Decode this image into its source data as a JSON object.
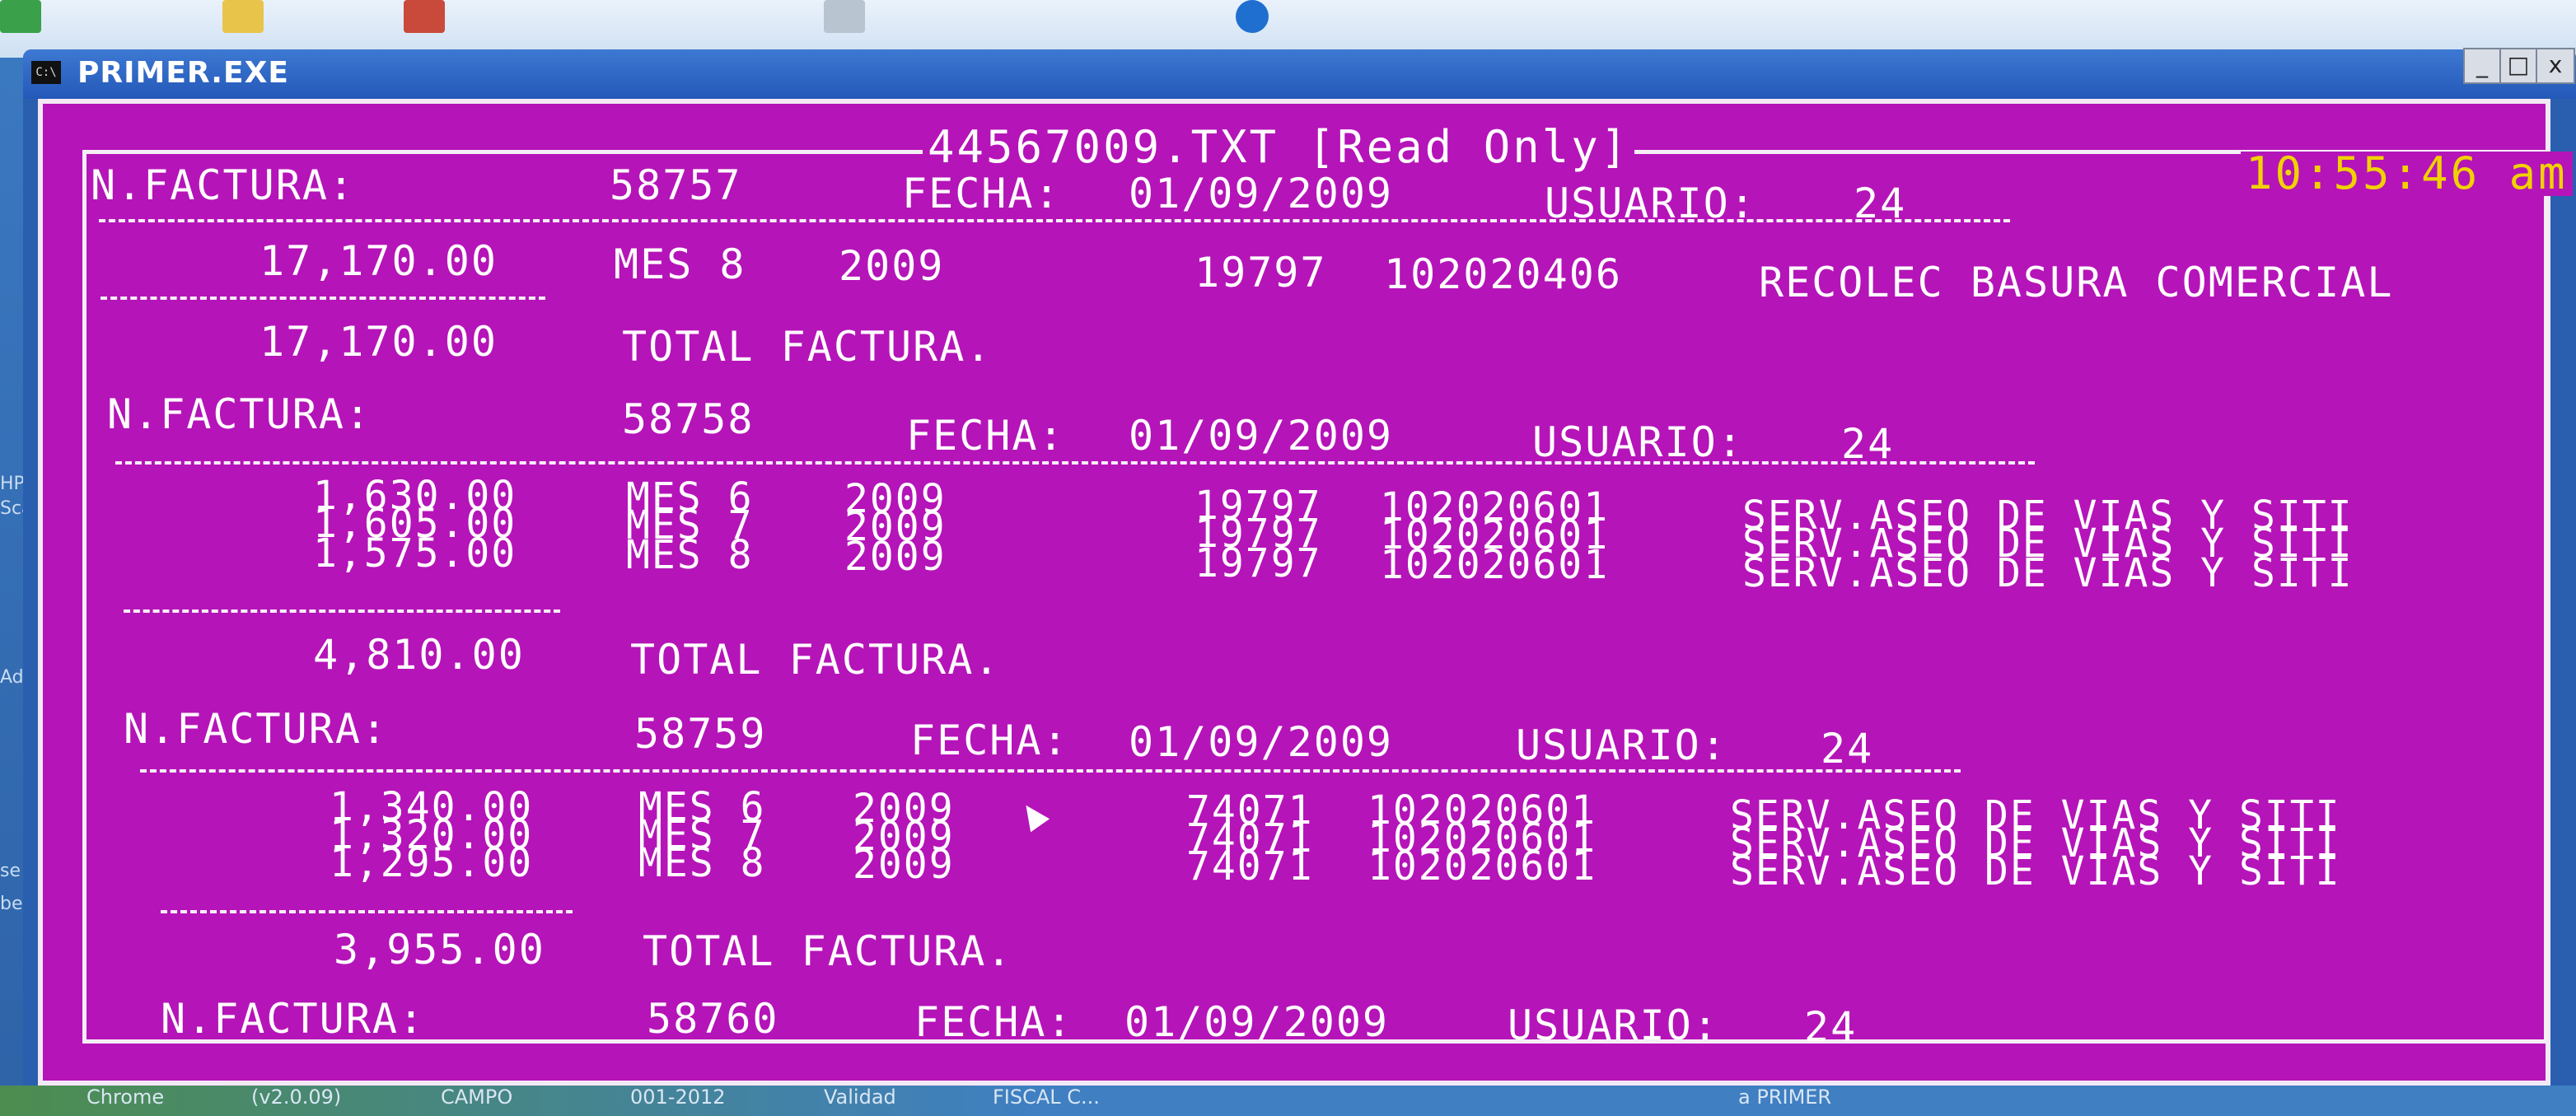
{
  "window": {
    "title": "PRIMER.EXE",
    "icon_glyph": "C:\\",
    "controls": [
      "_",
      "□",
      "x"
    ]
  },
  "desktop": {
    "left_labels": [
      "HP",
      "Sca",
      "Ado",
      "se",
      "bes"
    ],
    "taskbar_items": [
      "Chrome",
      "(v2.0.09)",
      "CAMPO",
      "001-2012",
      "Validad",
      "FISCAL C...",
      "a PRIMER"
    ]
  },
  "console": {
    "file_title": "44567009.TXT [Read Only]",
    "clock": "10:55:46 am",
    "bg_color": "#b514b8",
    "text_color": "#ffffff",
    "clock_color": "#f0d200",
    "invoices": [
      {
        "label": "N.FACTURA:",
        "number": "58757",
        "fecha_label": "FECHA:",
        "fecha": "01/09/2009",
        "usuario_label": "USUARIO:",
        "usuario": "24",
        "lines": [
          {
            "amount": "17,170.00",
            "mes": "MES 8",
            "year": "2009",
            "code1": "19797",
            "code2": "102020406",
            "desc": "RECOLEC BASURA COMERCIAL"
          }
        ],
        "total": "17,170.00",
        "total_label": "TOTAL FACTURA."
      },
      {
        "label": "N.FACTURA:",
        "number": "58758",
        "fecha_label": "FECHA:",
        "fecha": "01/09/2009",
        "usuario_label": "USUARIO:",
        "usuario": "24",
        "lines": [
          {
            "amount": "1,630.00",
            "mes": "MES 6",
            "year": "2009",
            "code1": "19797",
            "code2": "102020601",
            "desc": "SERV.ASEO DE VIAS Y SITI"
          },
          {
            "amount": "1,605.00",
            "mes": "MES 7",
            "year": "2009",
            "code1": "19797",
            "code2": "102020601",
            "desc": "SERV.ASEO DE VIAS Y SITI"
          },
          {
            "amount": "1,575.00",
            "mes": "MES 8",
            "year": "2009",
            "code1": "19797",
            "code2": "102020601",
            "desc": "SERV.ASEO DE VIAS Y SITI"
          }
        ],
        "total": "4,810.00",
        "total_label": "TOTAL FACTURA."
      },
      {
        "label": "N.FACTURA:",
        "number": "58759",
        "fecha_label": "FECHA:",
        "fecha": "01/09/2009",
        "usuario_label": "USUARIO:",
        "usuario": "24",
        "lines": [
          {
            "amount": "1,340.00",
            "mes": "MES 6",
            "year": "2009",
            "code1": "74071",
            "code2": "102020601",
            "desc": "SERV.ASEO DE VIAS Y SITI"
          },
          {
            "amount": "1,320.00",
            "mes": "MES 7",
            "year": "2009",
            "code1": "74071",
            "code2": "102020601",
            "desc": "SERV.ASEO DE VIAS Y SITI"
          },
          {
            "amount": "1,295.00",
            "mes": "MES 8",
            "year": "2009",
            "code1": "74071",
            "code2": "102020601",
            "desc": "SERV.ASEO DE VIAS Y SITI"
          }
        ],
        "total": "3,955.00",
        "total_label": "TOTAL FACTURA."
      },
      {
        "label": "N.FACTURA:",
        "number": "58760",
        "fecha_label": "FECHA:",
        "fecha": "01/09/2009",
        "usuario_label": "USUARIO:",
        "usuario": "24"
      }
    ]
  }
}
